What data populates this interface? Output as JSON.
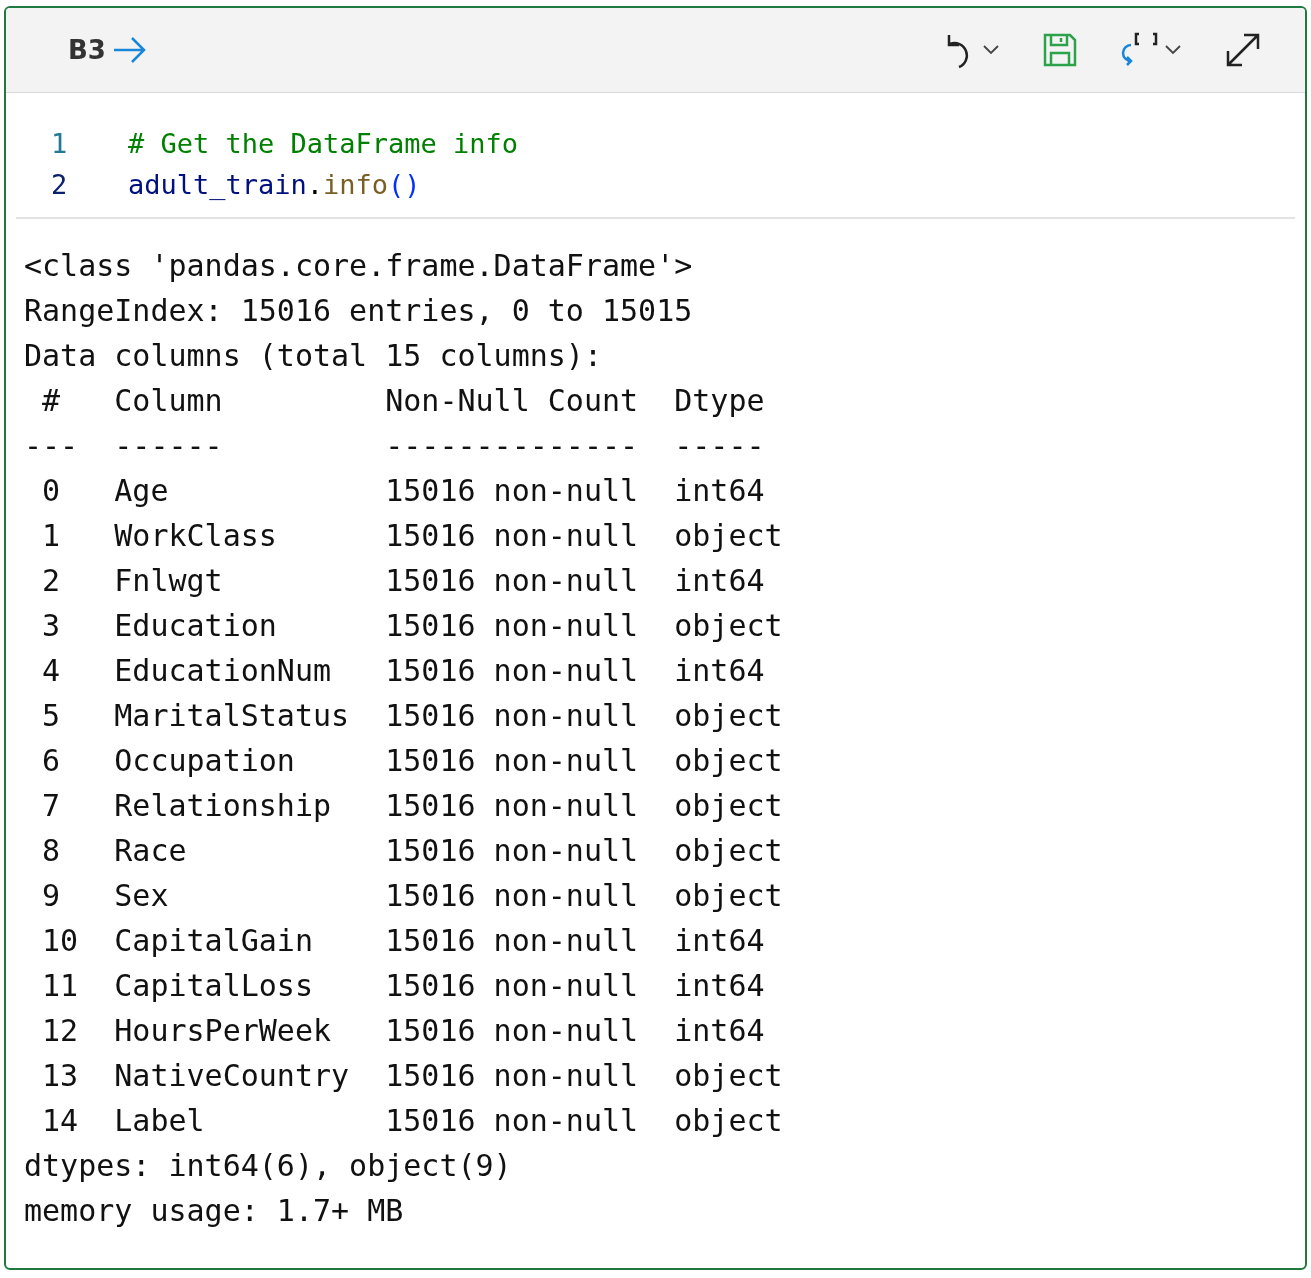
{
  "header": {
    "cell_ref": "B3"
  },
  "code": {
    "lines": [
      {
        "number": "1",
        "tokens": [
          {
            "kind": "comment",
            "text": "# Get the DataFrame info"
          }
        ]
      },
      {
        "number": "2",
        "tokens": [
          {
            "kind": "name",
            "text": "adult_train"
          },
          {
            "kind": "plain",
            "text": "."
          },
          {
            "kind": "func",
            "text": "info"
          },
          {
            "kind": "paren",
            "text": "()"
          }
        ]
      }
    ]
  },
  "output": {
    "lines": [
      "<class 'pandas.core.frame.DataFrame'>",
      "RangeIndex: 15016 entries, 0 to 15015",
      "Data columns (total 15 columns):",
      " #   Column         Non-Null Count  Dtype ",
      "---  ------         --------------  ----- ",
      " 0   Age            15016 non-null  int64 ",
      " 1   WorkClass      15016 non-null  object",
      " 2   Fnlwgt         15016 non-null  int64 ",
      " 3   Education      15016 non-null  object",
      " 4   EducationNum   15016 non-null  int64 ",
      " 5   MaritalStatus  15016 non-null  object",
      " 6   Occupation     15016 non-null  object",
      " 7   Relationship   15016 non-null  object",
      " 8   Race           15016 non-null  object",
      " 9   Sex            15016 non-null  object",
      " 10  CapitalGain    15016 non-null  int64 ",
      " 11  CapitalLoss    15016 non-null  int64 ",
      " 12  HoursPerWeek   15016 non-null  int64 ",
      " 13  NativeCountry  15016 non-null  object",
      " 14  Label          15016 non-null  object",
      "dtypes: int64(6), object(9)",
      "memory usage: 1.7+ MB"
    ]
  }
}
